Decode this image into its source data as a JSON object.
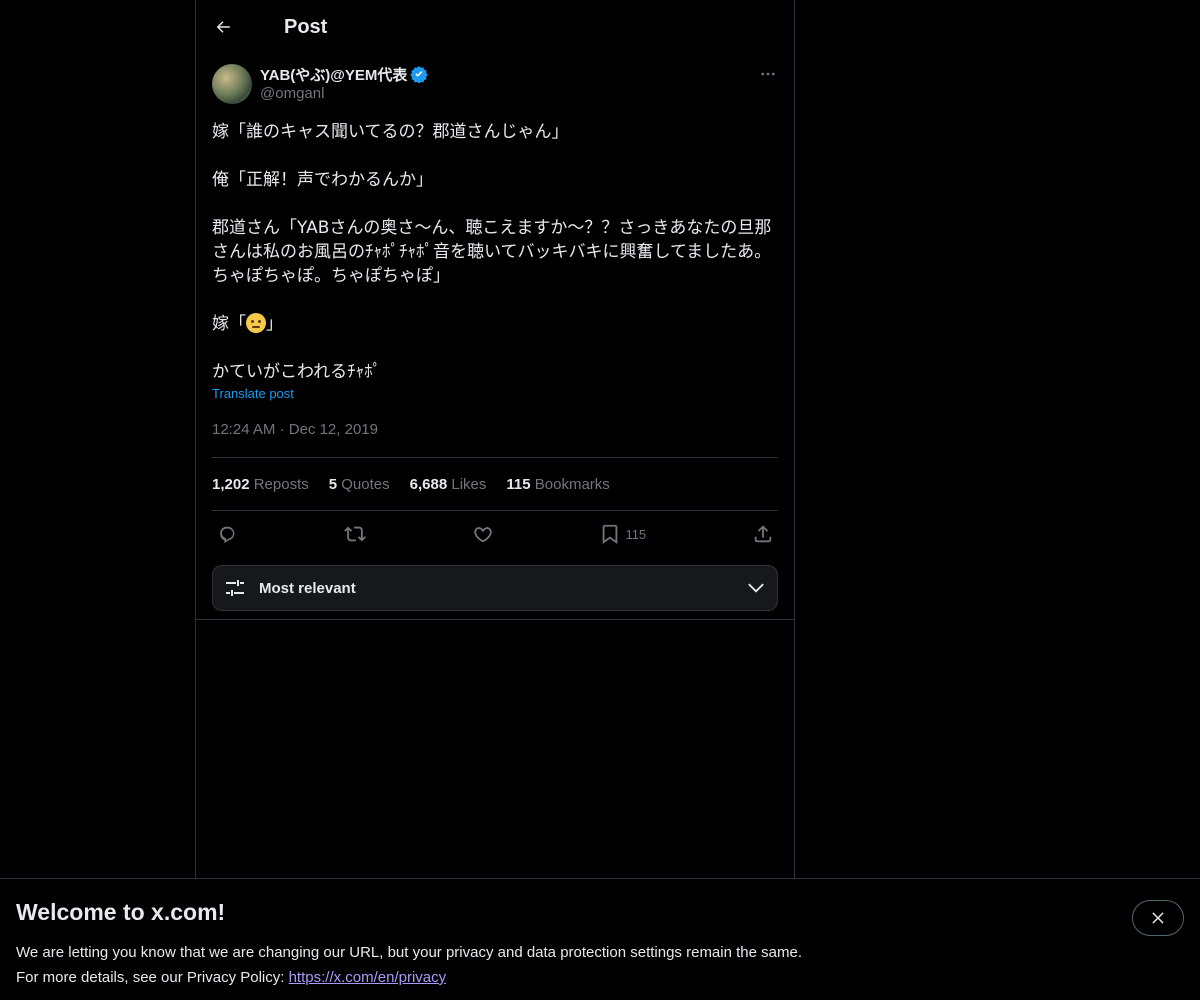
{
  "header": {
    "title": "Post",
    "back_icon": "arrow-left-icon"
  },
  "post": {
    "author": {
      "display_name": "YAB(やぶ)@YEM代表",
      "handle": "@omganl",
      "verified": true
    },
    "text_lines": [
      "嫁「誰のキャス聞いてるの？郡道さんじゃん」",
      "",
      "俺「正解！声でわかるんか」",
      "",
      "郡道さん「YABさんの奥さ〜ん、聴こえますか〜？？さっきあなたの旦那",
      "さんは私のお風呂のﾁｬﾎﾟﾁｬﾎﾟ音を聴いてバッキバキに興奮してましたあ。",
      "ちゃぽちゃぽ。ちゃぽちゃぽ」",
      "",
      "EMOJI_LINE",
      "",
      "かていがこわれるﾁｬﾎﾟ"
    ],
    "emoji_line_prefix": "嫁「",
    "emoji_line_suffix": "」",
    "emoji_icon": "face-with-rolling-eyes-icon",
    "translate_label": "Translate post",
    "time": "12:24 AM",
    "separator": "·",
    "date": "Dec 12, 2019"
  },
  "stats": {
    "reposts_count": "1,202",
    "reposts_label": "Reposts",
    "quotes_count": "5",
    "quotes_label": "Quotes",
    "likes_count": "6,688",
    "likes_label": "Likes",
    "bookmarks_count": "115",
    "bookmarks_label": "Bookmarks"
  },
  "actions": {
    "reply_icon": "reply-icon",
    "repost_icon": "repost-icon",
    "like_icon": "heart-icon",
    "bookmark_icon": "bookmark-icon",
    "bookmark_count": "115",
    "share_icon": "share-icon"
  },
  "sort": {
    "label": "Most relevant"
  },
  "banner": {
    "title": "Welcome to x.com!",
    "line1": "We are letting you know that we are changing our URL, but your privacy and data protection settings remain the same.",
    "line2_prefix": "For more details, see our Privacy Policy: ",
    "link_text": "https://x.com/en/privacy"
  },
  "colors": {
    "background": "#000000",
    "text": "#e7e9ea",
    "muted": "#71767b",
    "accent": "#1d9bf0",
    "verified": "#1d9bf0"
  }
}
